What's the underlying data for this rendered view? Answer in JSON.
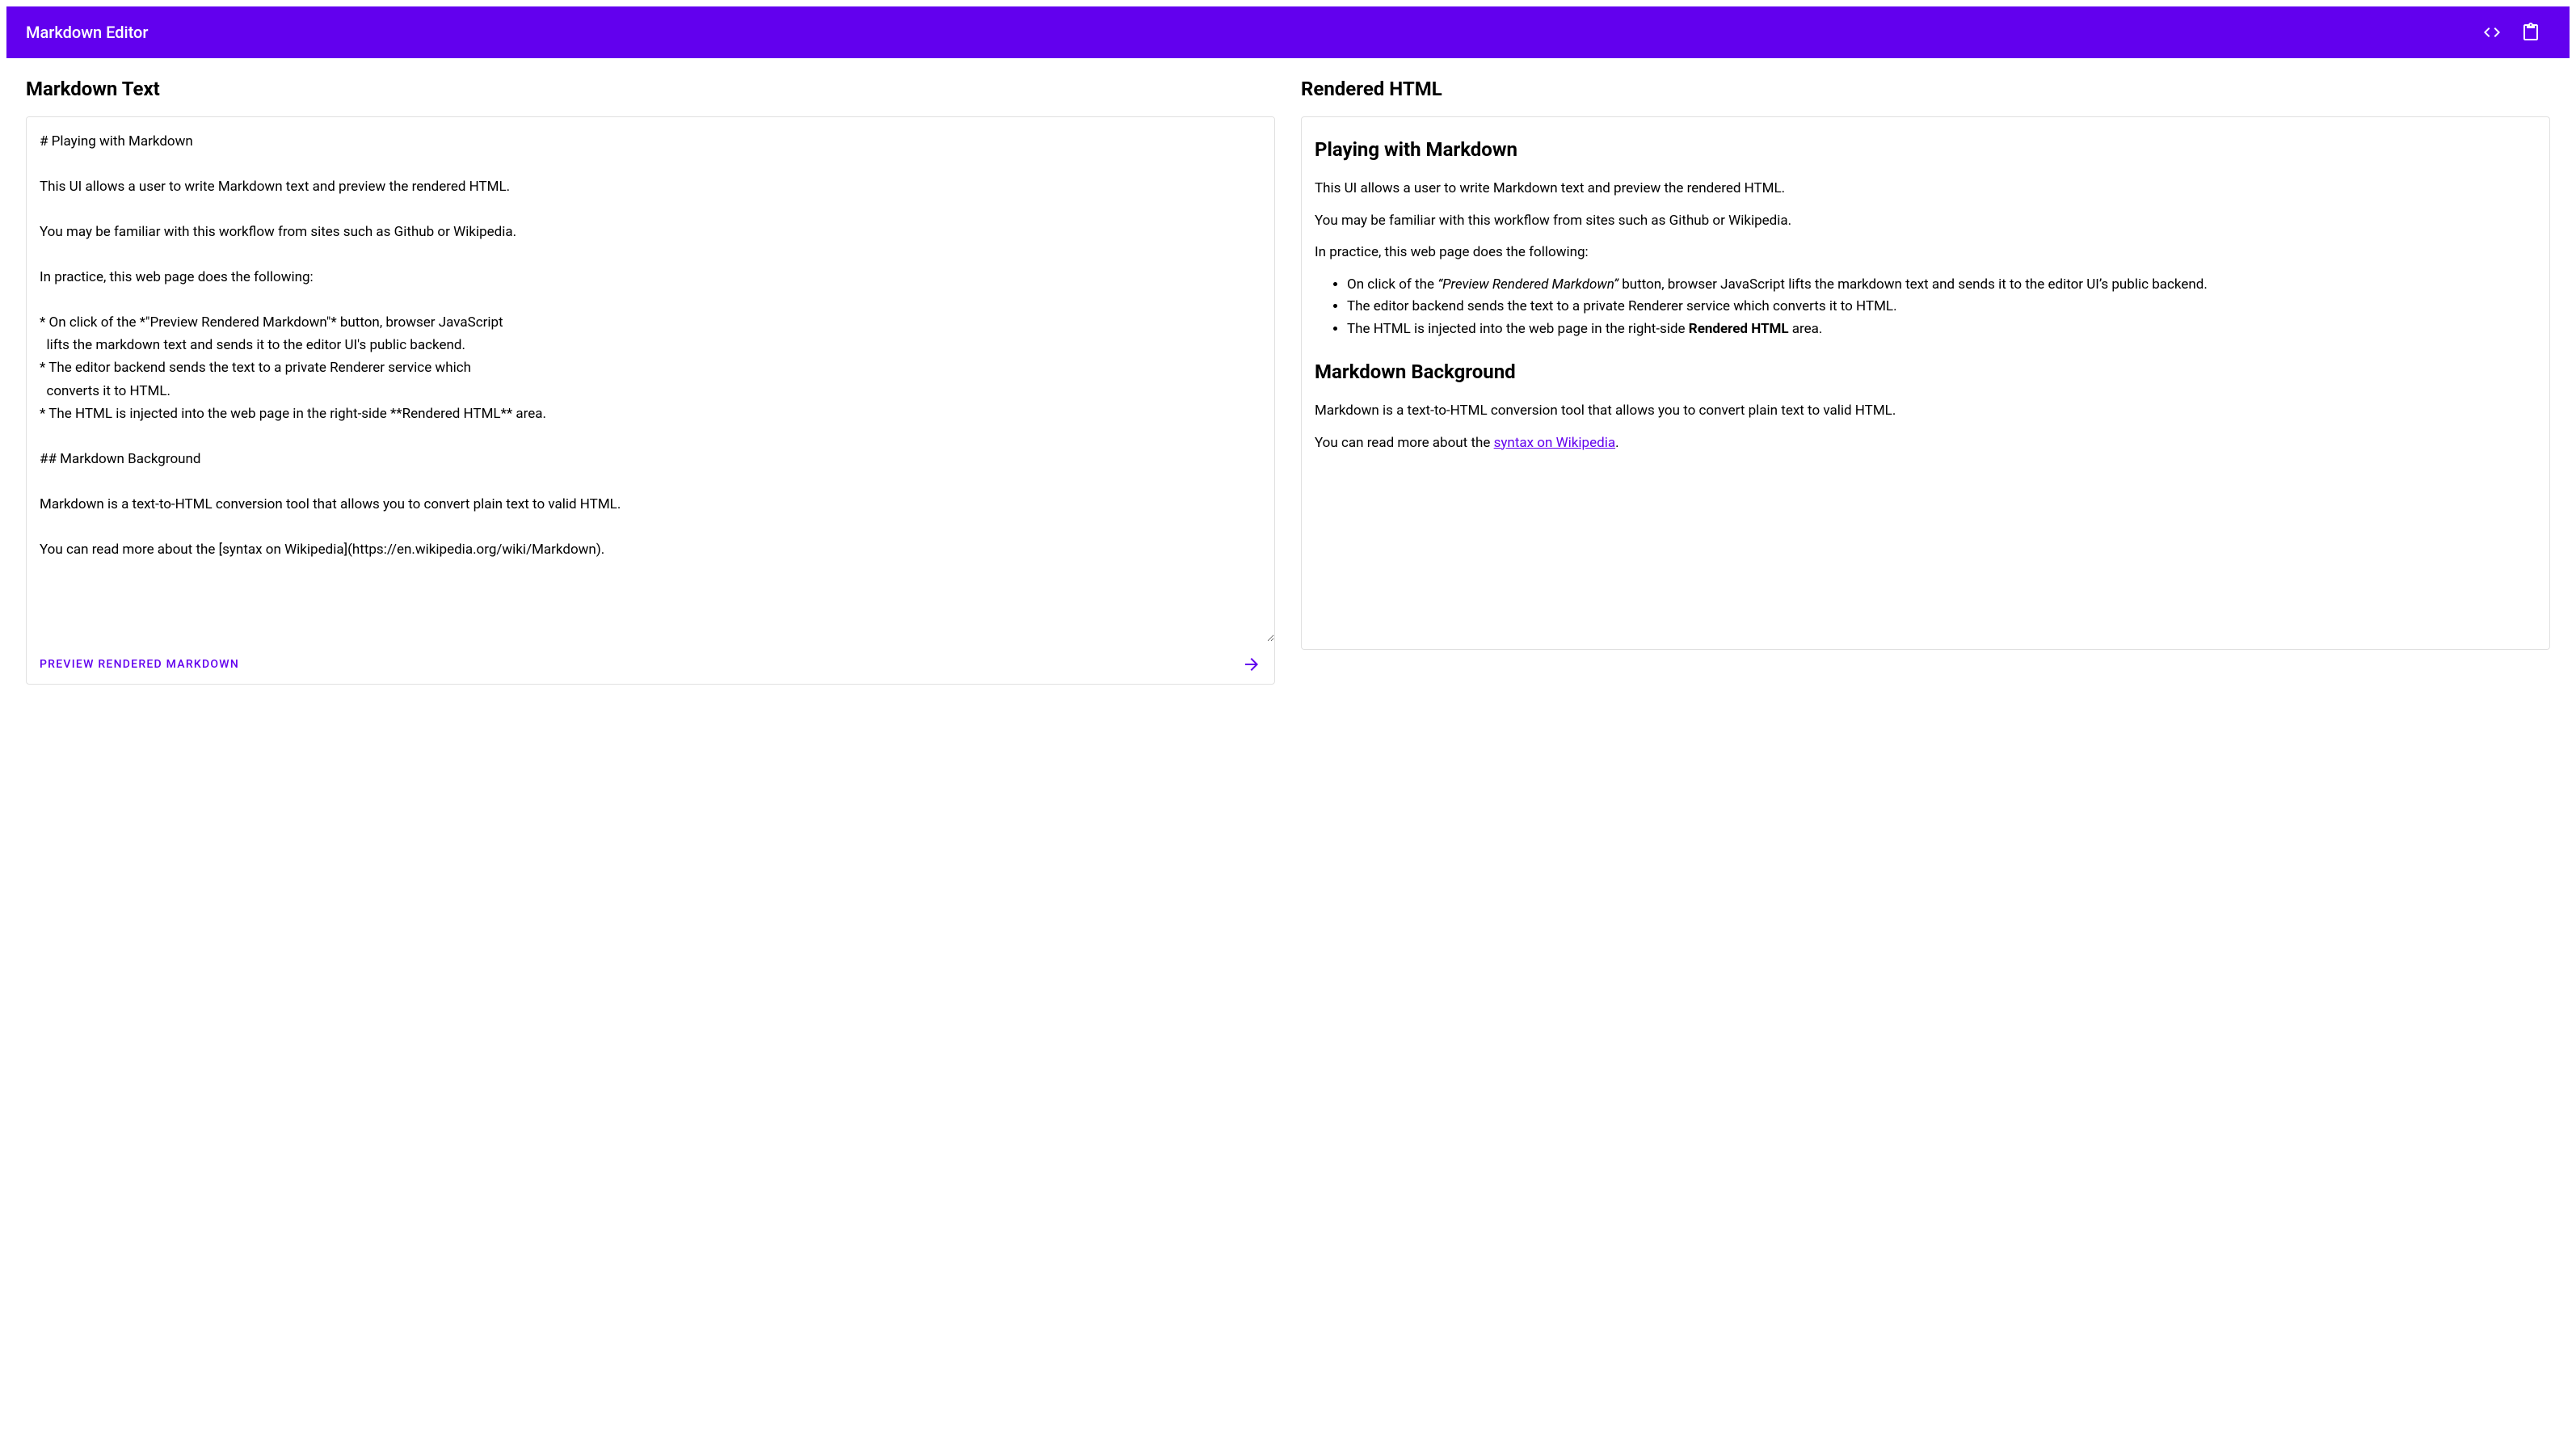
{
  "header": {
    "title": "Markdown Editor"
  },
  "left": {
    "heading": "Markdown Text",
    "textarea_value": "# Playing with Markdown\n\nThis UI allows a user to write Markdown text and preview the rendered HTML.\n\nYou may be familiar with this workflow from sites such as Github or Wikipedia.\n\nIn practice, this web page does the following:\n\n* On click of the *\"Preview Rendered Markdown\"* button, browser JavaScript\n  lifts the markdown text and sends it to the editor UI's public backend.\n* The editor backend sends the text to a private Renderer service which\n  converts it to HTML.\n* The HTML is injected into the web page in the right-side **Rendered HTML** area.\n\n## Markdown Background\n\nMarkdown is a text-to-HTML conversion tool that allows you to convert plain text to valid HTML.\n\nYou can read more about the [syntax on Wikipedia](https://en.wikipedia.org/wiki/Markdown).",
    "preview_button": "Preview Rendered Markdown"
  },
  "right": {
    "heading": "Rendered HTML",
    "h1": "Playing with Markdown",
    "p1": "This UI allows a user to write Markdown text and preview the rendered HTML.",
    "p2": "You may be familiar with this workflow from sites such as Github or Wikipedia.",
    "p3": "In practice, this web page does the following:",
    "li1_pre": "On click of the ",
    "li1_em": "“Preview Rendered Markdown”",
    "li1_post": " button, browser JavaScript lifts the markdown text and sends it to the editor UI’s public backend.",
    "li2": "The editor backend sends the text to a private Renderer service which converts it to HTML.",
    "li3_pre": "The HTML is injected into the web page in the right-side ",
    "li3_strong": "Rendered HTML",
    "li3_post": " area.",
    "h2": "Markdown Background",
    "p4": "Markdown is a text-to-HTML conversion tool that allows you to convert plain text to valid HTML.",
    "p5_pre": "You can read more about the ",
    "p5_link": "syntax on Wikipedia",
    "p5_post": "."
  }
}
